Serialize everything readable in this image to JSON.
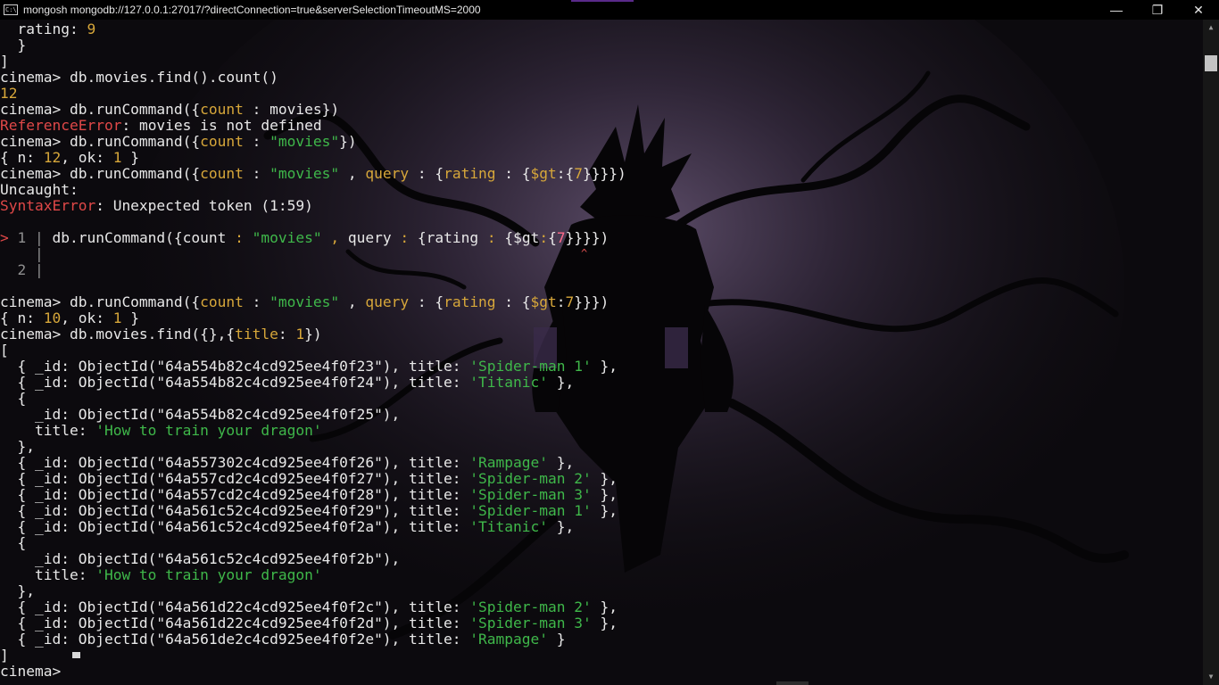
{
  "window": {
    "title": "mongosh mongodb://127.0.0.1:27017/?directConnection=true&serverSelectionTimeoutMS=2000",
    "icon_name": "terminal-app-icon",
    "icon_text": "C:\\",
    "minimize_glyph": "—",
    "maximize_glyph": "❐",
    "close_glyph": "✕"
  },
  "colors": {
    "text": "#e8e8e8",
    "number_key": "#d7a73a",
    "error": "#e04848",
    "string": "#3fb84a",
    "gutter": "#8f8f8f"
  },
  "terminal": {
    "lines": [
      [
        {
          "t": "  rating: "
        },
        {
          "t": "9",
          "c": "y"
        }
      ],
      [
        {
          "t": "  }"
        }
      ],
      [
        {
          "t": "]"
        }
      ],
      [
        {
          "t": "cinema> db.movies.find().count()"
        }
      ],
      [
        {
          "t": "12",
          "c": "y"
        }
      ],
      [
        {
          "t": "cinema> db.runCommand({"
        },
        {
          "t": "count",
          "c": "y"
        },
        {
          "t": " : movies})"
        }
      ],
      [
        {
          "t": "ReferenceError",
          "c": "r"
        },
        {
          "t": ": movies is not defined"
        }
      ],
      [
        {
          "t": "cinema> db.runCommand({"
        },
        {
          "t": "count",
          "c": "y"
        },
        {
          "t": " : "
        },
        {
          "t": "\"movies\"",
          "c": "g"
        },
        {
          "t": "})"
        }
      ],
      [
        {
          "t": "{ n: "
        },
        {
          "t": "12",
          "c": "y"
        },
        {
          "t": ", ok: "
        },
        {
          "t": "1",
          "c": "y"
        },
        {
          "t": " }"
        }
      ],
      [
        {
          "t": "cinema> db.runCommand({"
        },
        {
          "t": "count",
          "c": "y"
        },
        {
          "t": " : "
        },
        {
          "t": "\"movies\"",
          "c": "g"
        },
        {
          "t": " , "
        },
        {
          "t": "query",
          "c": "y"
        },
        {
          "t": " : {"
        },
        {
          "t": "rating",
          "c": "y"
        },
        {
          "t": " : {"
        },
        {
          "t": "$gt",
          "c": "y"
        },
        {
          "t": ":{"
        },
        {
          "t": "7",
          "c": "y"
        },
        {
          "t": "}}}})"
        }
      ],
      [
        {
          "t": "Uncaught:"
        }
      ],
      [
        {
          "t": "SyntaxError",
          "c": "r"
        },
        {
          "t": ": Unexpected token (1:59)"
        }
      ],
      [],
      [
        {
          "t": "> ",
          "c": "r"
        },
        {
          "t": "1 | ",
          "c": "gy"
        },
        {
          "t": "db.runCommand({count "
        },
        {
          "t": ":",
          "c": "y"
        },
        {
          "t": " "
        },
        {
          "t": "\"movies\"",
          "c": "g"
        },
        {
          "t": " "
        },
        {
          "t": ",",
          "c": "y"
        },
        {
          "t": " query "
        },
        {
          "t": ":",
          "c": "y"
        },
        {
          "t": " {rating "
        },
        {
          "t": ":",
          "c": "y"
        },
        {
          "t": " {$gt"
        },
        {
          "t": ":",
          "c": "y"
        },
        {
          "t": "{"
        },
        {
          "t": "7",
          "c": "pk"
        },
        {
          "t": "}}}})"
        }
      ],
      [
        {
          "t": "    | ",
          "c": "gy"
        }
      ],
      [
        {
          "t": "  2 | ",
          "c": "gy"
        }
      ],
      [],
      [
        {
          "t": "cinema> db.runCommand({"
        },
        {
          "t": "count",
          "c": "y"
        },
        {
          "t": " : "
        },
        {
          "t": "\"movies\"",
          "c": "g"
        },
        {
          "t": " , "
        },
        {
          "t": "query",
          "c": "y"
        },
        {
          "t": " : {"
        },
        {
          "t": "rating",
          "c": "y"
        },
        {
          "t": " : {"
        },
        {
          "t": "$gt",
          "c": "y"
        },
        {
          "t": ":"
        },
        {
          "t": "7",
          "c": "y"
        },
        {
          "t": "}}})"
        }
      ],
      [
        {
          "t": "{ n: "
        },
        {
          "t": "10",
          "c": "y"
        },
        {
          "t": ", ok: "
        },
        {
          "t": "1",
          "c": "y"
        },
        {
          "t": " }"
        }
      ],
      [
        {
          "t": "cinema> db.movies.find({},{"
        },
        {
          "t": "title",
          "c": "y"
        },
        {
          "t": ": "
        },
        {
          "t": "1",
          "c": "y"
        },
        {
          "t": "})"
        }
      ],
      [
        {
          "t": "["
        }
      ],
      [
        {
          "t": "  { _id: ObjectId(\"64a554b82c4cd925ee4f0f23\"), title: "
        },
        {
          "t": "'Spider-man 1'",
          "c": "g"
        },
        {
          "t": " },"
        }
      ],
      [
        {
          "t": "  { _id: ObjectId(\"64a554b82c4cd925ee4f0f24\"), title: "
        },
        {
          "t": "'Titanic'",
          "c": "g"
        },
        {
          "t": " },"
        }
      ],
      [
        {
          "t": "  {"
        }
      ],
      [
        {
          "t": "    _id: ObjectId(\"64a554b82c4cd925ee4f0f25\"),"
        }
      ],
      [
        {
          "t": "    title: "
        },
        {
          "t": "'How to train your dragon'",
          "c": "g"
        }
      ],
      [
        {
          "t": "  },"
        }
      ],
      [
        {
          "t": "  { _id: ObjectId(\"64a557302c4cd925ee4f0f26\"), title: "
        },
        {
          "t": "'Rampage'",
          "c": "g"
        },
        {
          "t": " },"
        }
      ],
      [
        {
          "t": "  { _id: ObjectId(\"64a557cd2c4cd925ee4f0f27\"), title: "
        },
        {
          "t": "'Spider-man 2'",
          "c": "g"
        },
        {
          "t": " },"
        }
      ],
      [
        {
          "t": "  { _id: ObjectId(\"64a557cd2c4cd925ee4f0f28\"), title: "
        },
        {
          "t": "'Spider-man 3'",
          "c": "g"
        },
        {
          "t": " },"
        }
      ],
      [
        {
          "t": "  { _id: ObjectId(\"64a561c52c4cd925ee4f0f29\"), title: "
        },
        {
          "t": "'Spider-man 1'",
          "c": "g"
        },
        {
          "t": " },"
        }
      ],
      [
        {
          "t": "  { _id: ObjectId(\"64a561c52c4cd925ee4f0f2a\"), title: "
        },
        {
          "t": "'Titanic'",
          "c": "g"
        },
        {
          "t": " },"
        }
      ],
      [
        {
          "t": "  {"
        }
      ],
      [
        {
          "t": "    _id: ObjectId(\"64a561c52c4cd925ee4f0f2b\"),"
        }
      ],
      [
        {
          "t": "    title: "
        },
        {
          "t": "'How to train your dragon'",
          "c": "g"
        }
      ],
      [
        {
          "t": "  },"
        }
      ],
      [
        {
          "t": "  { _id: ObjectId(\"64a561d22c4cd925ee4f0f2c\"), title: "
        },
        {
          "t": "'Spider-man 2'",
          "c": "g"
        },
        {
          "t": " },"
        }
      ],
      [
        {
          "t": "  { _id: ObjectId(\"64a561d22c4cd925ee4f0f2d\"), title: "
        },
        {
          "t": "'Spider-man 3'",
          "c": "g"
        },
        {
          "t": " },"
        }
      ],
      [
        {
          "t": "  { _id: ObjectId(\"64a561de2c4cd925ee4f0f2e\"), title: "
        },
        {
          "t": "'Rampage'",
          "c": "g"
        },
        {
          "t": " }"
        }
      ],
      [
        {
          "t": "]"
        }
      ],
      [
        {
          "t": "cinema> "
        }
      ]
    ],
    "error_caret": "^",
    "prompt_cursor": "block-cursor"
  },
  "scrollbar": {
    "up_glyph": "▲",
    "down_glyph": "▼"
  }
}
